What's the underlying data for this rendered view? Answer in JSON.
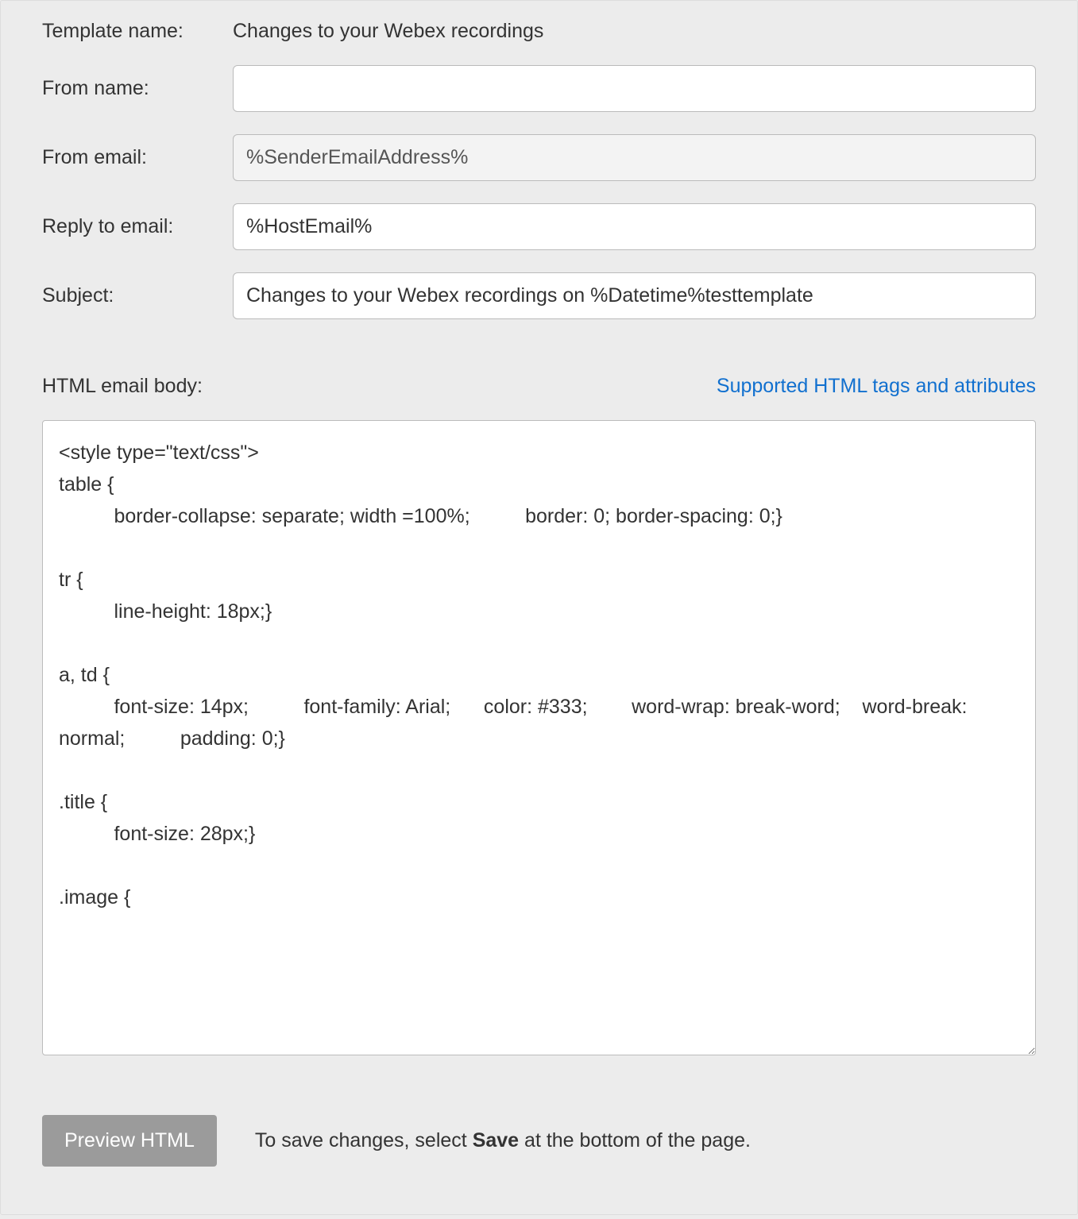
{
  "fields": {
    "template_name": {
      "label": "Template name:",
      "value": "Changes to your Webex recordings"
    },
    "from_name": {
      "label": "From name:",
      "value": ""
    },
    "from_email": {
      "label": "From email:",
      "value": "%SenderEmailAddress%"
    },
    "reply_to_email": {
      "label": "Reply to email:",
      "value": "%HostEmail%"
    },
    "subject": {
      "label": "Subject:",
      "value": "Changes to your Webex recordings on %Datetime%testtemplate"
    }
  },
  "html_body": {
    "label": "HTML email body:",
    "help_link": "Supported HTML tags and attributes",
    "content": "<style type=\"text/css\">\ntable {\n          border-collapse: separate; width =100%;          border: 0; border-spacing: 0;}\n\ntr {\n          line-height: 18px;}\n\na, td {\n          font-size: 14px;          font-family: Arial;      color: #333;        word-wrap: break-word;    word-break: normal;          padding: 0;}\n\n.title {\n          font-size: 28px;}\n\n.image {"
  },
  "footer": {
    "preview_button": "Preview HTML",
    "save_hint_pre": "To save changes, select ",
    "save_hint_bold": "Save",
    "save_hint_post": " at the bottom of the page."
  }
}
